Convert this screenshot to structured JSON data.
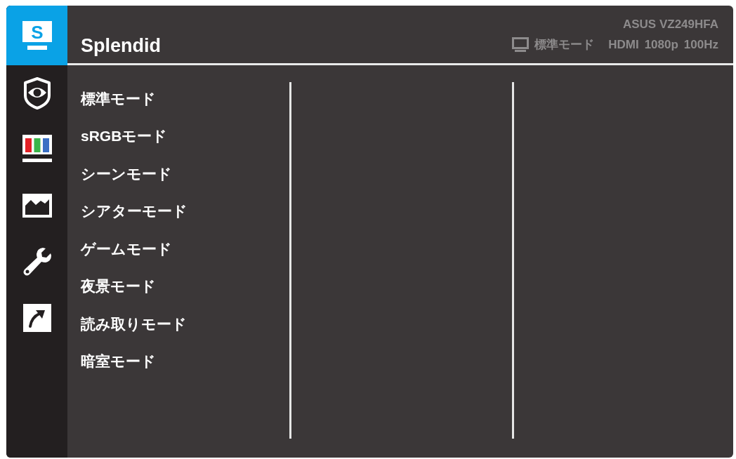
{
  "sidebar": {
    "items": [
      {
        "kind": "splendid",
        "letter": "S",
        "selected": true
      },
      {
        "kind": "eye-care",
        "selected": false
      },
      {
        "kind": "color",
        "selected": false
      },
      {
        "kind": "image",
        "selected": false
      },
      {
        "kind": "system",
        "selected": false
      },
      {
        "kind": "shortcut",
        "selected": false
      }
    ]
  },
  "header": {
    "title": "Splendid",
    "model": "ASUS VZ249HFA",
    "status": {
      "mode": "標準モード",
      "input": "HDMI",
      "resolution": "1080p",
      "refresh": "100Hz"
    }
  },
  "menu": {
    "items": [
      "標準モード",
      "sRGBモード",
      "シーンモード",
      "シアターモード",
      "ゲームモード",
      "夜景モード",
      "読み取りモード",
      "暗室モード"
    ]
  }
}
